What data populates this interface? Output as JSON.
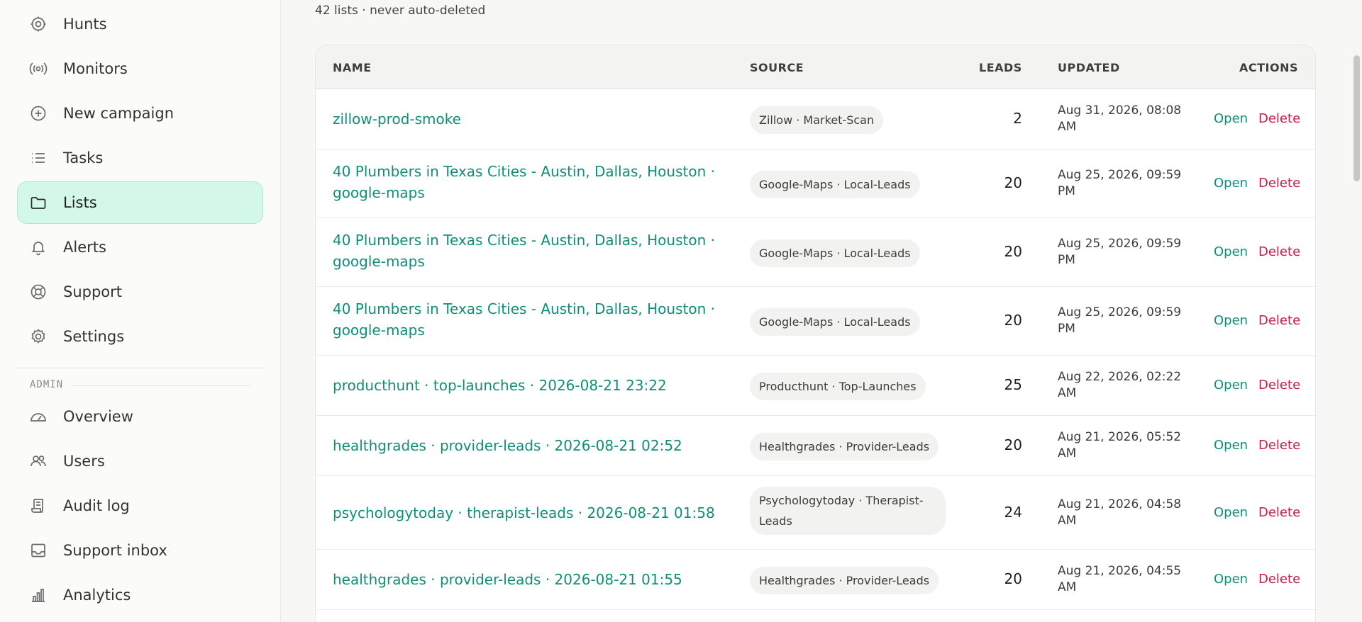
{
  "sidebar": {
    "items": [
      {
        "label": "Hunts",
        "icon": "target-icon"
      },
      {
        "label": "Monitors",
        "icon": "broadcast-icon"
      },
      {
        "label": "New campaign",
        "icon": "plus-circle-icon"
      },
      {
        "label": "Tasks",
        "icon": "list-icon"
      },
      {
        "label": "Lists",
        "icon": "folder-icon",
        "active": true
      },
      {
        "label": "Alerts",
        "icon": "bell-icon"
      },
      {
        "label": "Support",
        "icon": "lifebuoy-icon"
      },
      {
        "label": "Settings",
        "icon": "gear-icon"
      }
    ],
    "admin_label": "ADMIN",
    "admin_items": [
      {
        "label": "Overview",
        "icon": "gauge-icon"
      },
      {
        "label": "Users",
        "icon": "users-icon"
      },
      {
        "label": "Audit log",
        "icon": "scroll-icon"
      },
      {
        "label": "Support inbox",
        "icon": "inbox-icon"
      },
      {
        "label": "Analytics",
        "icon": "bar-chart-icon"
      }
    ]
  },
  "main": {
    "summary": "42 lists · never auto-deleted",
    "table": {
      "headers": {
        "name": "NAME",
        "source": "SOURCE",
        "leads": "LEADS",
        "updated": "UPDATED",
        "actions": "ACTIONS"
      },
      "open_label": "Open",
      "delete_label": "Delete",
      "rows": [
        {
          "name": "zillow-prod-smoke",
          "source": "Zillow · Market-Scan",
          "leads": "2",
          "updated": "Aug 31, 2026, 08:08 AM"
        },
        {
          "name": "40 Plumbers in Texas Cities - Austin, Dallas, Houston · google-maps",
          "source": "Google-Maps · Local-Leads",
          "leads": "20",
          "updated": "Aug 25, 2026, 09:59 PM"
        },
        {
          "name": "40 Plumbers in Texas Cities - Austin, Dallas, Houston · google-maps",
          "source": "Google-Maps · Local-Leads",
          "leads": "20",
          "updated": "Aug 25, 2026, 09:59 PM"
        },
        {
          "name": "40 Plumbers in Texas Cities - Austin, Dallas, Houston · google-maps",
          "source": "Google-Maps · Local-Leads",
          "leads": "20",
          "updated": "Aug 25, 2026, 09:59 PM"
        },
        {
          "name": "producthunt · top-launches · 2026-08-21 23:22",
          "source": "Producthunt · Top-Launches",
          "leads": "25",
          "updated": "Aug 22, 2026, 02:22 AM"
        },
        {
          "name": "healthgrades · provider-leads · 2026-08-21 02:52",
          "source": "Healthgrades · Provider-Leads",
          "leads": "20",
          "updated": "Aug 21, 2026, 05:52 AM"
        },
        {
          "name": "psychologytoday · therapist-leads · 2026-08-21 01:58",
          "source": "Psychologytoday · Therapist-Leads",
          "leads": "24",
          "updated": "Aug 21, 2026, 04:58 AM"
        },
        {
          "name": "healthgrades · provider-leads · 2026-08-21 01:55",
          "source": "Healthgrades · Provider-Leads",
          "leads": "20",
          "updated": "Aug 21, 2026, 04:55 AM"
        }
      ]
    }
  }
}
